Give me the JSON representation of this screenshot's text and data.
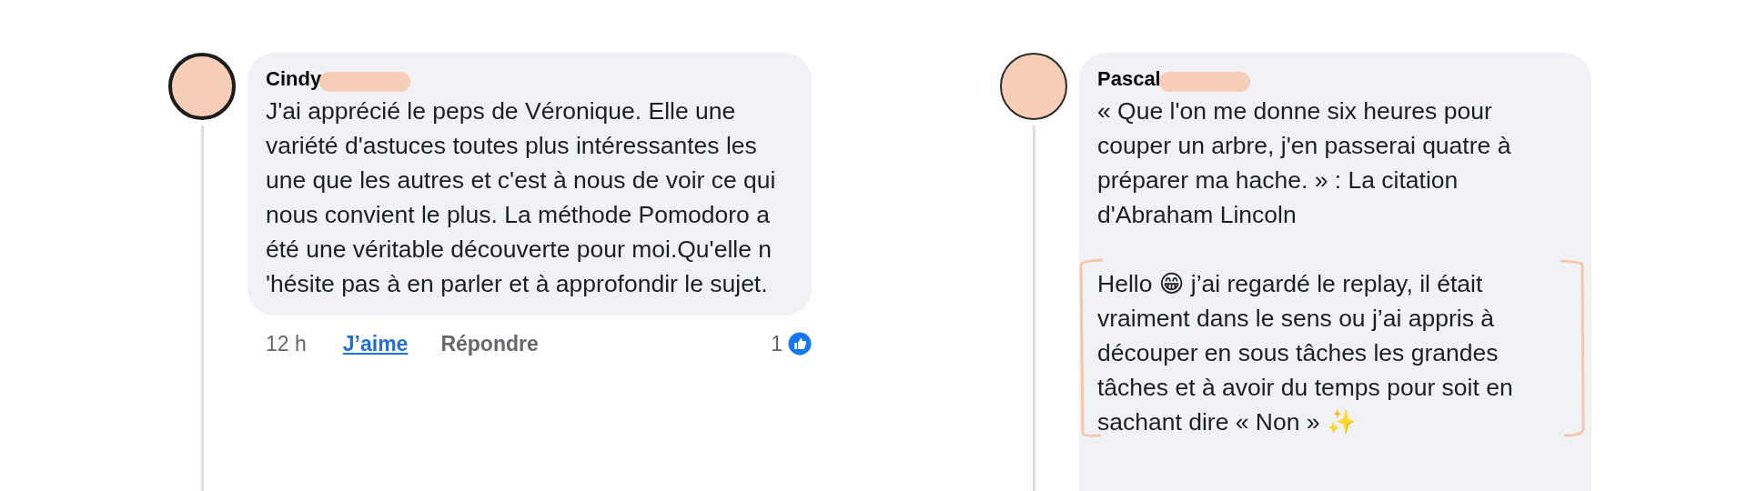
{
  "comments": [
    {
      "author": "Cindy",
      "paragraphs": [
        {
          "text": "J'ai apprécié le peps de Véronique. Elle une variété d'astuces toutes plus intéressantes les une que les autres et c'est à nous de voir ce qui nous convient le plus. La méthode Pomodoro a été une véritable découverte pour moi.Qu'elle n 'hésite pas à en parler et à approfondir le sujet.",
          "highlighted": false
        }
      ],
      "footer": {
        "time": "12 h",
        "like": "J’aime",
        "reply": "Répondre",
        "reaction_count": "1"
      }
    },
    {
      "author": "Pascal",
      "paragraphs": [
        {
          "text": "« Que l'on me donne six heures pour couper un arbre, j'en passerai quatre à préparer ma hache. » : La citation d'Abraham Lincoln",
          "highlighted": false
        },
        {
          "text": "Hello 😁 j’ai regardé le replay, il était vraiment dans le sens ou j’ai appris à découper en sous tâches les grandes tâches et à avoir du temps pour soit en sachant dire « Non » ✨",
          "highlighted": true
        }
      ]
    }
  ]
}
